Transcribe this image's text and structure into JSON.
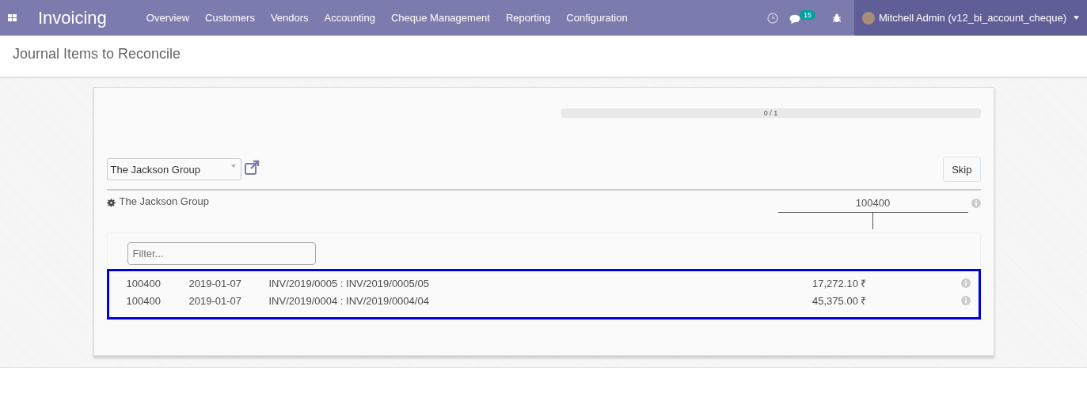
{
  "navbar": {
    "app_title": "Invoicing",
    "menu": [
      {
        "label": "Overview"
      },
      {
        "label": "Customers"
      },
      {
        "label": "Vendors"
      },
      {
        "label": "Accounting"
      },
      {
        "label": "Cheque Management"
      },
      {
        "label": "Reporting"
      },
      {
        "label": "Configuration"
      }
    ],
    "message_count": "15",
    "user": "Mitchell Admin (v12_bi_account_cheque)"
  },
  "page_title": "Journal Items to Reconcile",
  "progress": {
    "level": 0,
    "reading": "0 / 1"
  },
  "partner_select": {
    "value": "The Jackson Group"
  },
  "skip_button": "Skip",
  "partner_line": {
    "name": "The Jackson Group",
    "account": "100400"
  },
  "filter": {
    "placeholder": "Filter..."
  },
  "candidates": {
    "highlighted": true,
    "rows": [
      {
        "account": "100400",
        "date": "2019-01-07",
        "label": "INV/2019/0005 : INV/2019/0005/05",
        "amount": "17,272.10 ₹"
      },
      {
        "account": "100400",
        "date": "2019-01-07",
        "label": "INV/2019/0004 : INV/2019/0004/04",
        "amount": "45,375.00 ₹"
      }
    ]
  }
}
